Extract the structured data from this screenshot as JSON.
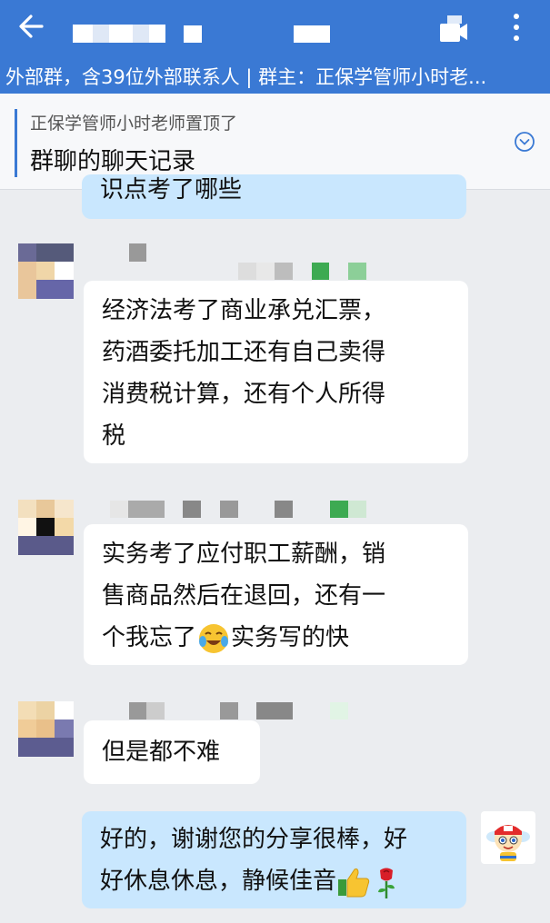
{
  "header": {
    "back_icon": "arrow-left-icon",
    "video_icon": "video-call-icon",
    "more_icon": "more-vertical-icon",
    "subtitle": "外部群，含39位外部联系人 | 群主：正保学管师小时老..."
  },
  "pinned": {
    "by": "正保学管师小时老师置顶了",
    "title": "群聊的聊天记录",
    "icon": "chevron-down-circle-icon"
  },
  "messages": [
    {
      "direction": "out",
      "lines": [
        "识点考了哪些"
      ]
    },
    {
      "direction": "in",
      "lines": [
        "经济法考了商业承兑汇票，",
        "药酒委托加工还有自己卖得",
        "消费税计算，还有个人所得",
        "税"
      ]
    },
    {
      "direction": "in",
      "lines": [
        "实务考了应付职工薪酬，销",
        "售商品然后在退回，还有一",
        "个我忘了",
        "实务写的快"
      ],
      "emoji": "crying-laughing-emoji"
    },
    {
      "direction": "in",
      "lines": [
        "但是都不难"
      ]
    },
    {
      "direction": "out",
      "lines": [
        "好的，谢谢您的分享很棒，好",
        "好休息休息，静候佳音"
      ],
      "emoji": [
        "thumbs-up-emoji",
        "rose-emoji"
      ]
    }
  ],
  "colors": {
    "header_bg": "#3a79d4",
    "chat_bg": "#ebedf0",
    "in_bubble": "#ffffff",
    "out_bubble": "#c9e7fe"
  }
}
